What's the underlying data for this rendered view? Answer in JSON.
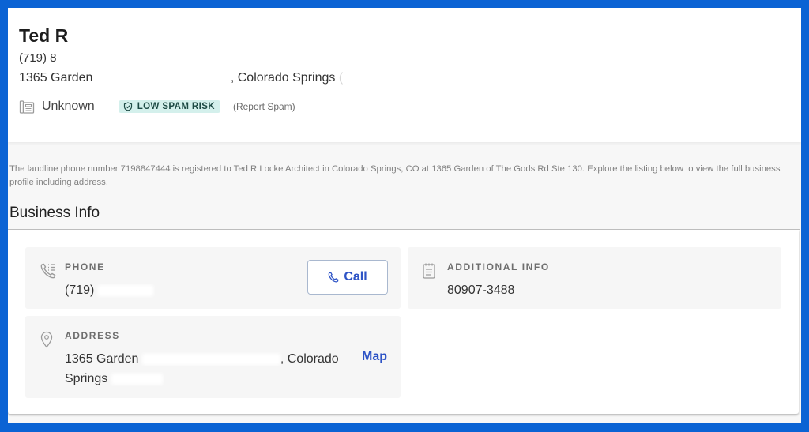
{
  "header": {
    "name_visible": "Ted R",
    "phone_visible": "(719) 8",
    "address_start": "1365 Garden",
    "address_city": ", Colorado Springs",
    "line_type": "Unknown",
    "spam_badge": "LOW SPAM RISK",
    "report_spam": "(Report Spam)"
  },
  "description": "The landline phone number 7198847444 is registered to Ted R Locke Architect in Colorado Springs, CO at 1365 Garden of The Gods Rd Ste 130. Explore the listing below to view the full business profile including address.",
  "business_info": {
    "title": "Business Info",
    "phone": {
      "label": "PHONE",
      "value_visible": "(719)",
      "call_label": "Call"
    },
    "additional_info": {
      "label": "ADDITIONAL INFO",
      "value": "80907-3488"
    },
    "address": {
      "label": "ADDRESS",
      "line1_start": "1365 Garden",
      "line1_end": ", Colorado",
      "line2_start": "Springs",
      "map_label": "Map"
    }
  },
  "colors": {
    "frame_border": "#0b63d4",
    "accent_link": "#2e54c6",
    "spam_badge_bg": "#d4f0ec",
    "tile_bg": "#f6f6f6"
  }
}
